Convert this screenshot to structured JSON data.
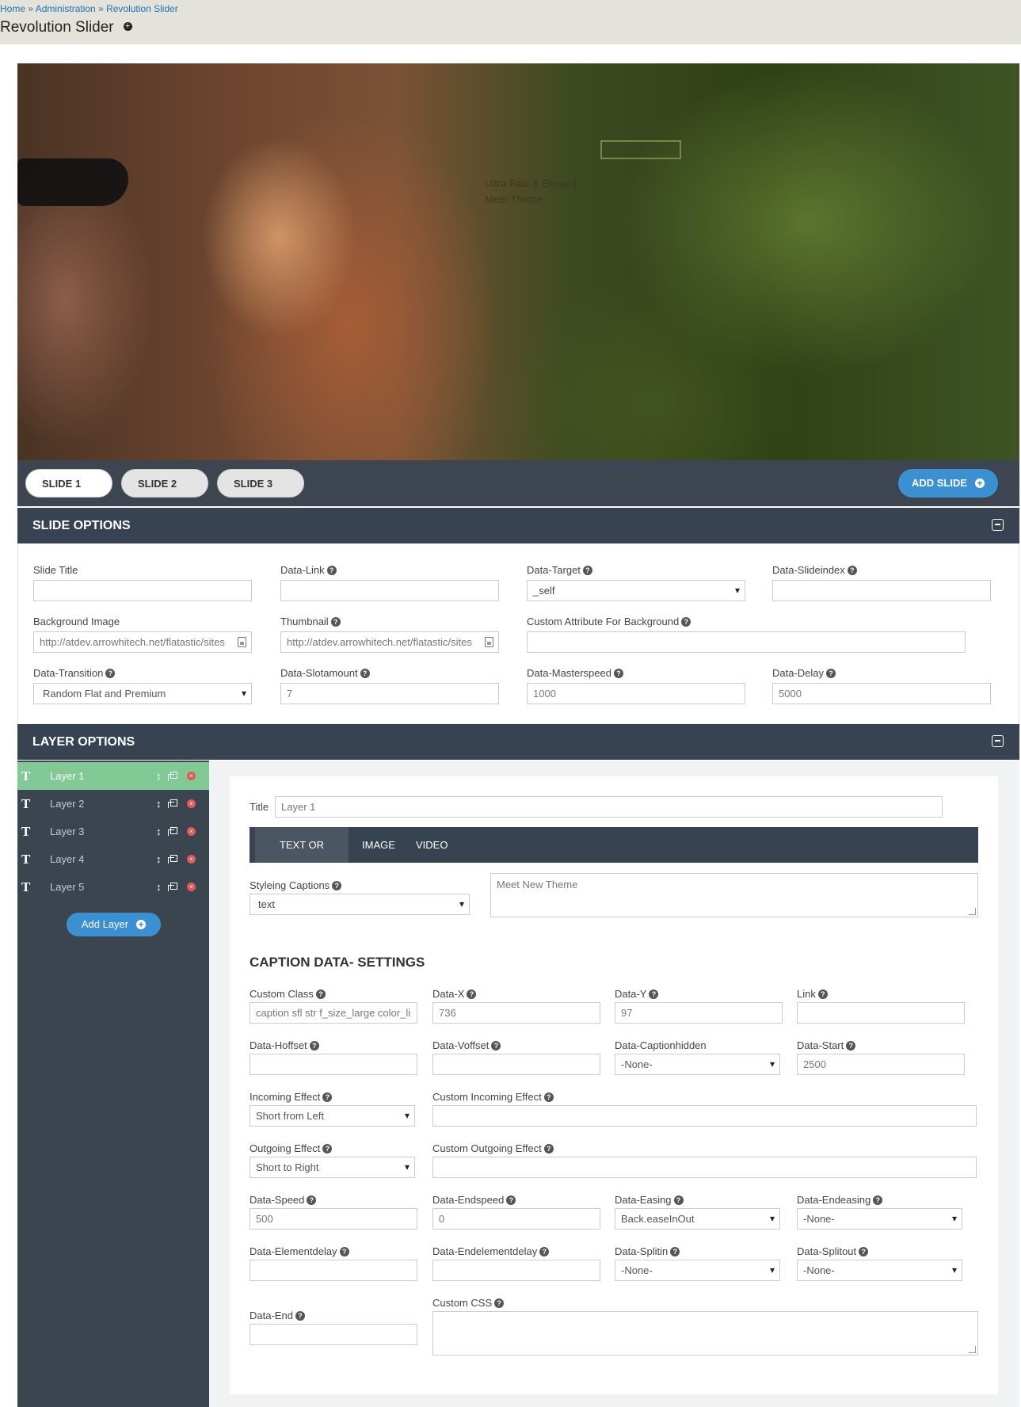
{
  "breadcrumb": {
    "home": "Home",
    "sep1": " » ",
    "admin": "Administration",
    "sep2": " » ",
    "current": "Revolution Slider"
  },
  "page": {
    "title": "Revolution Slider"
  },
  "hero": {
    "caption_line1": "Ultra Fast & Elegant",
    "caption_line2": "Meet Theme"
  },
  "slides": {
    "tabs": [
      {
        "label": "SLIDE 1"
      },
      {
        "label": "SLIDE 2"
      },
      {
        "label": "SLIDE 3"
      }
    ],
    "add_label": "ADD SLIDE"
  },
  "slide_options": {
    "header": "SLIDE OPTIONS",
    "slide_title": {
      "label": "Slide Title",
      "value": ""
    },
    "data_link": {
      "label": "Data-Link",
      "value": ""
    },
    "data_target": {
      "label": "Data-Target",
      "value": "_self"
    },
    "data_slideindex": {
      "label": "Data-Slideindex",
      "value": ""
    },
    "background_image": {
      "label": "Background Image",
      "value": "http://atdev.arrowhitech.net/flatastic/sites"
    },
    "thumbnail": {
      "label": "Thumbnail",
      "value": "http://atdev.arrowhitech.net/flatastic/sites"
    },
    "custom_attr": {
      "label": "Custom Attribute For Background",
      "value": ""
    },
    "data_transition": {
      "label": "Data-Transition",
      "value": "Random Flat and Premium"
    },
    "data_slotamount": {
      "label": "Data-Slotamount",
      "value": "7"
    },
    "data_masterspeed": {
      "label": "Data-Masterspeed",
      "value": "1000"
    },
    "data_delay": {
      "label": "Data-Delay",
      "value": "5000"
    }
  },
  "layer_options": {
    "header": "LAYER OPTIONS",
    "layers": [
      {
        "name": "Layer 1"
      },
      {
        "name": "Layer 2"
      },
      {
        "name": "Layer 3"
      },
      {
        "name": "Layer 4"
      },
      {
        "name": "Layer 5"
      }
    ],
    "layer_glyph": "T",
    "add_layer_label": "Add Layer",
    "title_label": "Title",
    "title_placeholder": "Layer 1",
    "tabs": [
      "TEXT OR HTML",
      "IMAGE",
      "VIDEO"
    ],
    "styleing_captions": {
      "label": "Styleing Captions",
      "value": "text"
    },
    "caption_text": "Meet New Theme",
    "caption_settings_heading": "CAPTION DATA- SETTINGS",
    "custom_class": {
      "label": "Custom Class",
      "value": "caption sfl str f_size_large color_li"
    },
    "data_x": {
      "label": "Data-X",
      "value": "736"
    },
    "data_y": {
      "label": "Data-Y",
      "value": "97"
    },
    "link": {
      "label": "Link",
      "value": ""
    },
    "data_hoffset": {
      "label": "Data-Hoffset",
      "value": ""
    },
    "data_voffset": {
      "label": "Data-Voffset",
      "value": ""
    },
    "data_captionhidden": {
      "label": "Data-Captionhidden",
      "value": "-None-"
    },
    "data_start": {
      "label": "Data-Start",
      "value": "2500"
    },
    "incoming_effect": {
      "label": "Incoming Effect",
      "value": "Short from Left"
    },
    "custom_incoming": {
      "label": "Custom Incoming Effect",
      "value": ""
    },
    "outgoing_effect": {
      "label": "Outgoing Effect",
      "value": "Short to Right"
    },
    "custom_outgoing": {
      "label": "Custom Outgoing Effect",
      "value": ""
    },
    "data_speed": {
      "label": "Data-Speed",
      "value": "500"
    },
    "data_endspeed": {
      "label": "Data-Endspeed",
      "value": "0"
    },
    "data_easing": {
      "label": "Data-Easing",
      "value": "Back.easeInOut"
    },
    "data_endeasing": {
      "label": "Data-Endeasing",
      "value": "-None-"
    },
    "data_elementdelay": {
      "label": "Data-Elementdelay",
      "value": ""
    },
    "data_endelementdelay": {
      "label": "Data-Endelementdelay",
      "value": ""
    },
    "data_splitin": {
      "label": "Data-Splitin",
      "value": "-None-"
    },
    "data_splitout": {
      "label": "Data-Splitout",
      "value": "-None-"
    },
    "data_end": {
      "label": "Data-End",
      "value": ""
    },
    "custom_css": {
      "label": "Custom CSS",
      "value": ""
    }
  }
}
